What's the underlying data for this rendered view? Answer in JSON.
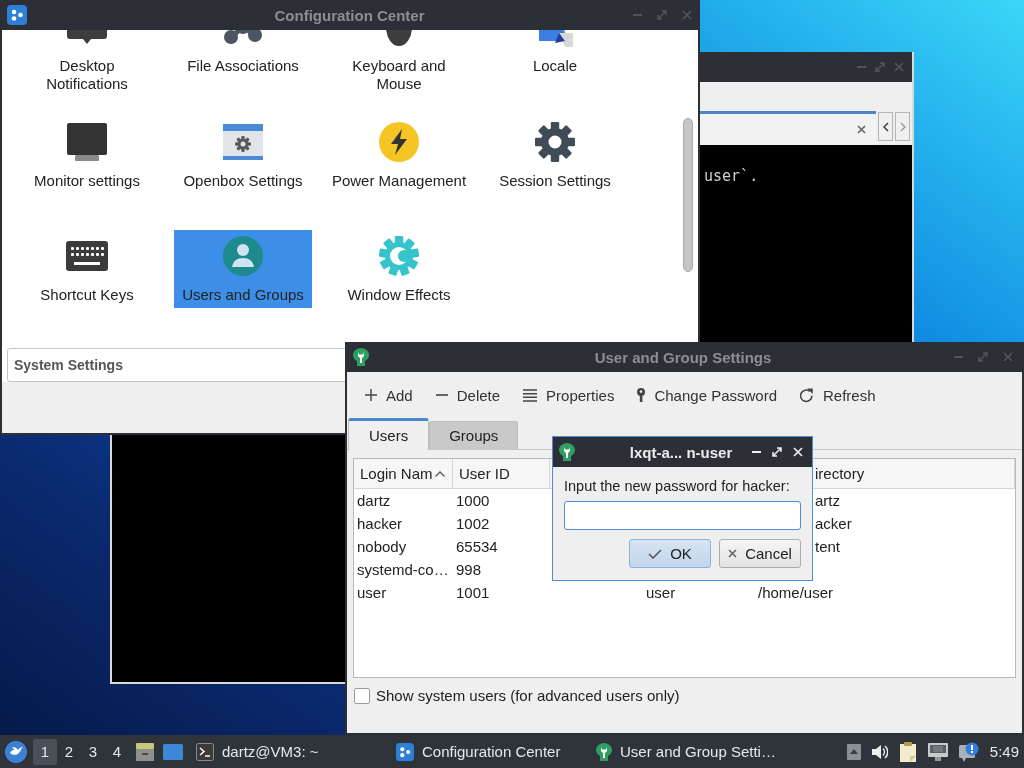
{
  "terminal_window": {
    "tabs": [
      {
        "selected": true
      }
    ],
    "output_lines": [
      "user`."
    ]
  },
  "configuration_center": {
    "title": "Configuration Center",
    "active": false,
    "items": [
      {
        "label": "Desktop Notifications",
        "selected": false
      },
      {
        "label": "File Associations",
        "selected": false
      },
      {
        "label": "Keyboard and Mouse",
        "selected": false
      },
      {
        "label": "Locale",
        "selected": false
      },
      {
        "label": "Monitor settings",
        "selected": false
      },
      {
        "label": "Openbox Settings",
        "selected": false
      },
      {
        "label": "Power Management",
        "selected": false
      },
      {
        "label": "Session Settings",
        "selected": false
      },
      {
        "label": "Shortcut Keys",
        "selected": false
      },
      {
        "label": "Users and Groups",
        "selected": true
      },
      {
        "label": "Window Effects",
        "selected": false
      }
    ],
    "category": "System Settings"
  },
  "user_group_settings": {
    "title": "User and Group Settings",
    "active": false,
    "toolbar": [
      "Add",
      "Delete",
      "Properties",
      "Change Password",
      "Refresh"
    ],
    "tabs": [
      {
        "label": "Users",
        "selected": true
      },
      {
        "label": "Groups",
        "selected": false
      }
    ],
    "table": {
      "columns": {
        "login_name": {
          "label": "Login Nam",
          "sorted": true
        },
        "user_id": {
          "label": "User ID"
        },
        "column_5": {
          "label": "irectory"
        }
      },
      "rows": [
        {
          "login_name": "dartz",
          "user_id": "1000",
          "column_5": "artz"
        },
        {
          "login_name": "hacker",
          "user_id": "1002",
          "column_5": "acker"
        },
        {
          "login_name": "nobody",
          "user_id": "65534",
          "column_5": "tent"
        },
        {
          "login_name": "systemd-co…",
          "user_id": "998"
        },
        {
          "login_name": "user",
          "user_id": "1001",
          "column_4": "user",
          "column_5": "/home/user"
        }
      ]
    },
    "show_system_users": {
      "label": "Show system users (for advanced users only)",
      "checked": false
    }
  },
  "password_dialog": {
    "title": "lxqt-a... n-user",
    "active": true,
    "prompt": "Input the new password for hacker:",
    "field": {
      "focused": true
    },
    "buttons": [
      {
        "label": "OK",
        "default": true
      },
      {
        "label": "Cancel",
        "default": false
      }
    ]
  },
  "taskbar": {
    "desktops": [
      {
        "label": "1",
        "selected": true
      },
      {
        "label": "2",
        "selected": false
      },
      {
        "label": "3",
        "selected": false
      },
      {
        "label": "4",
        "selected": false
      }
    ],
    "tasks": [
      {
        "label": "dartz@VM3: ~"
      },
      {
        "label": "Configuration Center"
      },
      {
        "label": "User and Group Setti…"
      }
    ],
    "clock": "5:49"
  }
}
